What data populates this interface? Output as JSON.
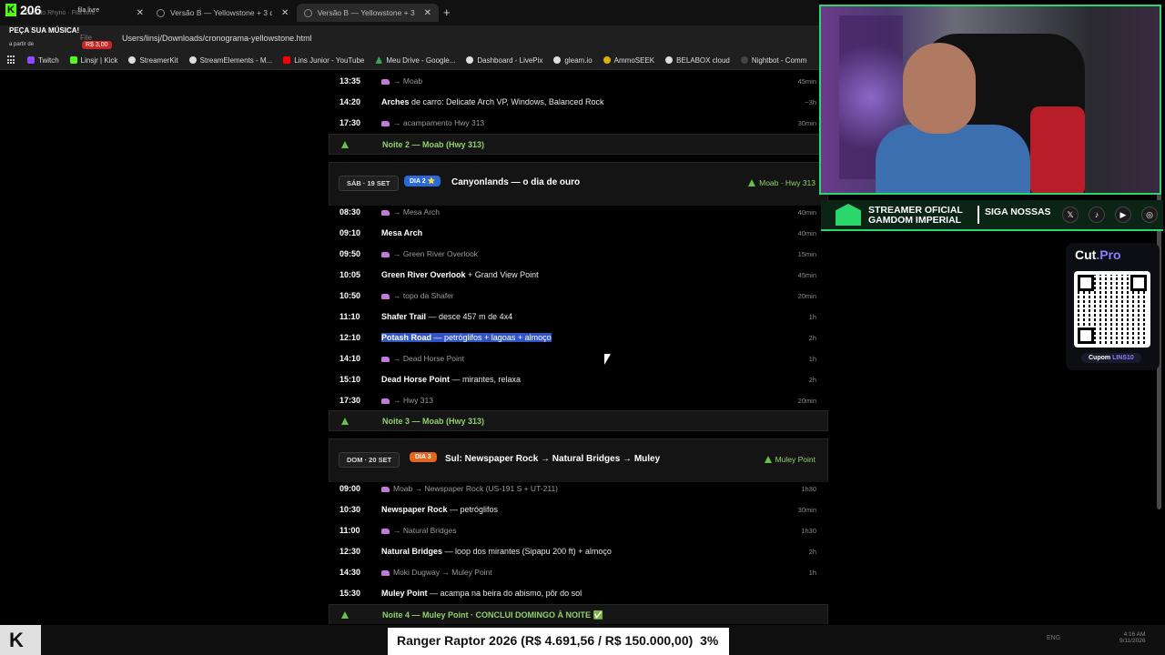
{
  "browser": {
    "tabs": [
      {
        "label": "Baú do Rhyno · Fila livre",
        "active": false
      },
      {
        "label": "Versão B — Yellowstone + 3 di",
        "active": false
      },
      {
        "label": "Versão B — Yellowstone + 3 di",
        "active": true
      }
    ],
    "url": "Users/linsj/Downloads/cronograma-yellowstone.html",
    "file_chip": "File",
    "bookmarks": [
      {
        "label": "Twitch",
        "color": "#9146ff"
      },
      {
        "label": "Linsjr | Kick",
        "color": "#53fc18"
      },
      {
        "label": "StreamerKit",
        "color": "#dddddd"
      },
      {
        "label": "StreamElements - M...",
        "color": "#dddddd"
      },
      {
        "label": "Lins Junior - YouTube",
        "color": "#ff0000"
      },
      {
        "label": "Meu Drive - Google...",
        "color": "#34a853"
      },
      {
        "label": "Dashboard - LivePix",
        "color": "#dddddd"
      },
      {
        "label": "gleam.io",
        "color": "#dddddd"
      },
      {
        "label": "AmmoSEEK",
        "color": "#e0b000"
      },
      {
        "label": "BELABOX cloud",
        "color": "#dddddd"
      },
      {
        "label": "Nightbot - Comm",
        "color": "#444444"
      }
    ]
  },
  "overlay": {
    "kick_count": "206",
    "kick_letter": "K",
    "fila": "fila livre",
    "peca": "PEÇA SUA MÚSICA!",
    "a_partir": "a partir de",
    "price": "R$ 3,00"
  },
  "schedule": {
    "top_rows": [
      {
        "time": "13:35",
        "desc": "→ Moab",
        "dur": "45min",
        "transit": true
      },
      {
        "time": "14:20",
        "bold": "Arches",
        "desc": " de carro: Delicate Arch VP, Windows, Balanced Rock",
        "dur": "~3h",
        "transit": false
      },
      {
        "time": "17:30",
        "desc": "→ acampamento Hwy 313",
        "dur": "30min",
        "transit": true
      }
    ],
    "night2": "Noite 2 — Moab (Hwy 313)",
    "day2": {
      "date": "SÁB · 19 SET",
      "pill": "DIA 2 ⭐",
      "title": "Canyonlands — o dia de ouro",
      "loc": "Moab · Hwy 313",
      "rows": [
        {
          "time": "08:30",
          "desc": "→ Mesa Arch",
          "dur": "40min",
          "transit": true
        },
        {
          "time": "09:10",
          "bold": "Mesa Arch",
          "desc": "",
          "dur": "40min",
          "transit": false
        },
        {
          "time": "09:50",
          "desc": "→ Green River Overlook",
          "dur": "15min",
          "transit": true
        },
        {
          "time": "10:05",
          "bold": "Green River Overlook",
          "desc": " + Grand View Point",
          "dur": "45min",
          "transit": false
        },
        {
          "time": "10:50",
          "desc": "→ topo da Shafer",
          "dur": "20min",
          "transit": true
        },
        {
          "time": "11:10",
          "bold": "Shafer Trail",
          "desc": " — desce 457 m de 4x4",
          "dur": "1h",
          "transit": false
        },
        {
          "time": "12:10",
          "bold": "Potash Road",
          "desc": " — petróglifos + lagoas + almoço",
          "dur": "2h",
          "transit": false,
          "selected": true
        },
        {
          "time": "14:10",
          "desc": "→ Dead Horse Point",
          "dur": "1h",
          "transit": true
        },
        {
          "time": "15:10",
          "bold": "Dead Horse Point",
          "desc": " — mirantes, relaxa",
          "dur": "2h",
          "transit": false
        },
        {
          "time": "17:30",
          "desc": "→ Hwy 313",
          "dur": "20min",
          "transit": true
        }
      ],
      "night": "Noite 3 — Moab (Hwy 313)"
    },
    "day3": {
      "date": "DOM · 20 SET",
      "pill": "DIA 3",
      "title": "Sul: Newspaper Rock → Natural Bridges → Muley",
      "loc": "Muley Point",
      "rows": [
        {
          "time": "09:00",
          "desc": "Moab → Newspaper Rock (US-191 S + UT-211)",
          "dur": "1h30",
          "transit": true
        },
        {
          "time": "10:30",
          "bold": "Newspaper Rock",
          "desc": " — petróglifos",
          "dur": "30min",
          "transit": false
        },
        {
          "time": "11:00",
          "desc": "→ Natural Bridges",
          "dur": "1h30",
          "transit": true
        },
        {
          "time": "12:30",
          "bold": "Natural Bridges",
          "desc": " — loop dos mirantes (Sipapu 200 ft) + almoço",
          "dur": "2h",
          "transit": false
        },
        {
          "time": "14:30",
          "desc": "Moki Dugway → Muley Point",
          "dur": "1h",
          "transit": true
        },
        {
          "time": "15:30",
          "bold": "Muley Point",
          "desc": " — acampa na beira do abismo, pôr do sol",
          "dur": "",
          "transit": false
        }
      ],
      "night": "Noite 4 — Muley Point · CONCLUI DOMINGO À NOITE ✅"
    }
  },
  "banner": {
    "line1": "STREAMER OFICIAL",
    "line2": "GAMDOM IMPERIAL",
    "siga": "SIGA NOSSAS",
    "socials": [
      "𝕏",
      "♪",
      "▶",
      "◎"
    ]
  },
  "cutpro": {
    "brand": "Cut",
    "brand_suffix": ".Pro",
    "cupom_label": "Cupom",
    "cupom_code": "LINS10"
  },
  "ticker": {
    "text": "Ranger Raptor 2026 (R$ 4.691,56 / R$ 150.000,00)",
    "percent": "3%"
  },
  "taskbar": {
    "brand": "K",
    "tray": "ENG",
    "clock_time": "4:16 AM",
    "clock_date": "9/11/2026"
  },
  "colors": {
    "accent_green": "#2bd66a",
    "night_green": "#8fd16a",
    "day2_pill": "#2a6ad8",
    "day3_pill": "#e1661f",
    "selection": "#2f55c9"
  }
}
